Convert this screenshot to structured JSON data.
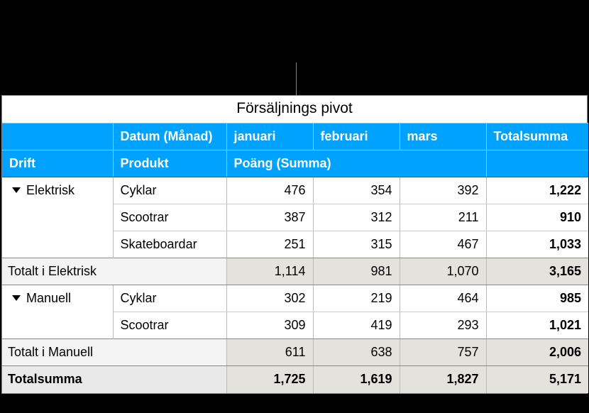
{
  "title": "Försäljnings pivot",
  "headers": {
    "date_field": "Datum (Månad)",
    "row_field1": "Drift",
    "row_field2": "Produkt",
    "value_field": "Poäng (Summa)",
    "months": {
      "jan": "januari",
      "feb": "februari",
      "mar": "mars"
    },
    "grand_col": "Totalsumma",
    "grand_row": "Totalsumma"
  },
  "groups": [
    {
      "name": "Elektrisk",
      "subtotal_label": "Totalt i Elektrisk",
      "rows": [
        {
          "product": "Cyklar",
          "jan": "476",
          "feb": "354",
          "mar": "392",
          "total": "1,222"
        },
        {
          "product": "Scootrar",
          "jan": "387",
          "feb": "312",
          "mar": "211",
          "total": "910"
        },
        {
          "product": "Skateboardar",
          "jan": "251",
          "feb": "315",
          "mar": "467",
          "total": "1,033"
        }
      ],
      "subtotal": {
        "jan": "1,114",
        "feb": "981",
        "mar": "1,070",
        "total": "3,165"
      }
    },
    {
      "name": "Manuell",
      "subtotal_label": "Totalt i Manuell",
      "rows": [
        {
          "product": "Cyklar",
          "jan": "302",
          "feb": "219",
          "mar": "464",
          "total": "985"
        },
        {
          "product": "Scootrar",
          "jan": "309",
          "feb": "419",
          "mar": "293",
          "total": "1,021"
        }
      ],
      "subtotal": {
        "jan": "611",
        "feb": "638",
        "mar": "757",
        "total": "2,006"
      }
    }
  ],
  "grand": {
    "jan": "1,725",
    "feb": "1,619",
    "mar": "1,827",
    "total": "5,171"
  }
}
